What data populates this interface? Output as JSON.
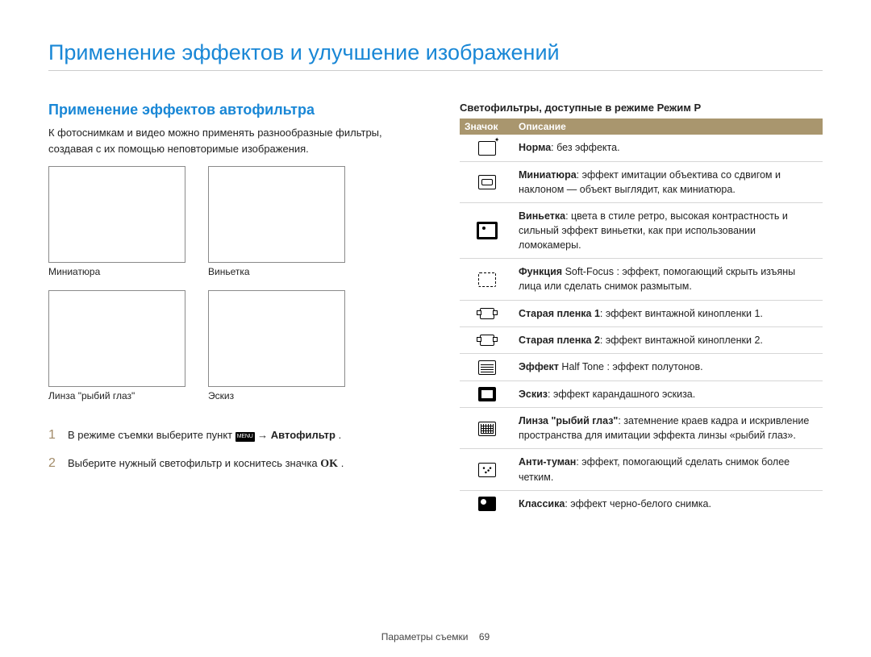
{
  "page": {
    "title": "Применение эффектов и улучшение изображений",
    "footer_label": "Параметры съемки",
    "footer_page": "69"
  },
  "left": {
    "section_title": "Применение эффектов автофильтра",
    "intro": "К фотоснимкам и видео можно применять разнообразные фильтры, создавая с их помощью неповторимые изображения.",
    "thumb_labels": {
      "miniature": "Миниатюра",
      "vignette": "Виньетка",
      "fisheye": "Линза \"рыбий глаз\"",
      "sketch": "Эскиз"
    },
    "steps": {
      "s1_pre": "В режиме съемки выберите пункт ",
      "s1_menu": "MENU",
      "s1_arrow": " → ",
      "s1_bold": "Автофильтр",
      "s1_post": ".",
      "s2_text": "Выберите нужный светофильтр и коснитесь значка ",
      "s2_ok": "OK",
      "s2_post": "."
    }
  },
  "right": {
    "table_title": "Светофильтры, доступные в режиме Режим P",
    "th_icon": "Значок",
    "th_desc": "Описание",
    "rows": [
      {
        "icon": "normal",
        "bold": "Норма",
        "rest": ": без эффекта."
      },
      {
        "icon": "mini",
        "bold": "Миниатюра",
        "rest": ": эффект имитации объектива со сдвигом и наклоном — объект выглядит, как миниатюра."
      },
      {
        "icon": "vignette",
        "bold": "Виньетка",
        "rest": ": цвета в стиле ретро, высокая контрастность и сильный эффект виньетки, как при использовании ломокамеры."
      },
      {
        "icon": "soft",
        "bold": "Функция",
        "mid": " Soft-Focus ",
        "rest": ": эффект, помогающий скрыть изъяны лица или сделать снимок размытым."
      },
      {
        "icon": "film",
        "bold": "Старая пленка 1",
        "rest": ": эффект винтажной кинопленки 1."
      },
      {
        "icon": "film",
        "bold": "Старая пленка 2",
        "rest": ": эффект винтажной кинопленки 2."
      },
      {
        "icon": "half",
        "bold": "Эффект",
        "mid": " Half Tone ",
        "rest": ": эффект полутонов."
      },
      {
        "icon": "sketch",
        "bold": "Эскиз",
        "rest": ": эффект карандашного эскиза."
      },
      {
        "icon": "fisheye",
        "bold": "Линза \"рыбий глаз\"",
        "rest": ": затемнение краев кадра и искривление пространства для имитации эффекта линзы «рыбий глаз»."
      },
      {
        "icon": "defog",
        "bold": "Анти-туман",
        "rest": ": эффект, помогающий сделать снимок более четким."
      },
      {
        "icon": "classic",
        "bold": "Классика",
        "rest": ": эффект черно-белого снимка."
      }
    ]
  }
}
